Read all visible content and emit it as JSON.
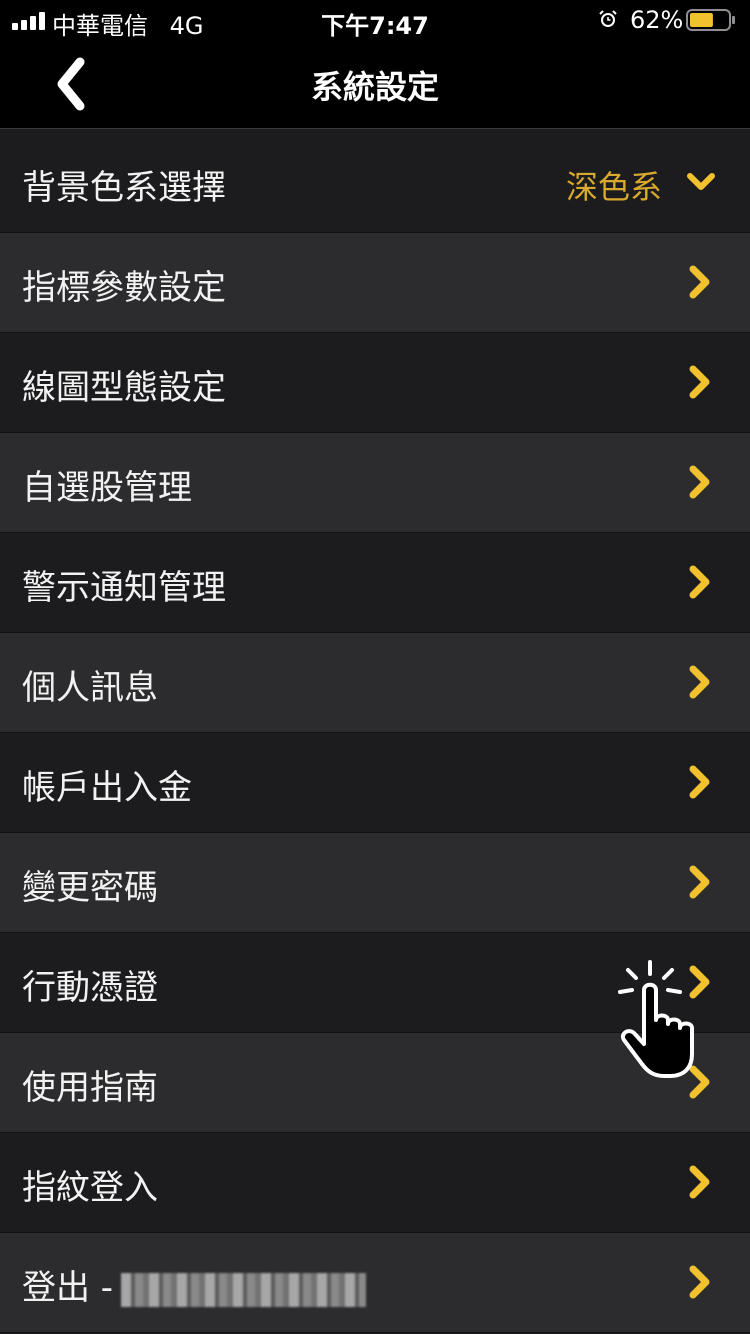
{
  "status_bar": {
    "carrier": "中華電信",
    "network": "4G",
    "time": "下午7:47",
    "battery_percent": "62%",
    "battery_level": 0.62
  },
  "nav": {
    "title": "系統設定"
  },
  "theme": {
    "accent": "#f2c12e",
    "value_color": "#d8a92d",
    "row_dark": "#1c1c1e",
    "row_light": "#2c2c2e"
  },
  "settings": {
    "background_color": {
      "label": "背景色系選擇",
      "value": "深色系"
    },
    "items": [
      {
        "label": "指標參數設定"
      },
      {
        "label": "線圖型態設定"
      },
      {
        "label": "自選股管理"
      },
      {
        "label": "警示通知管理"
      },
      {
        "label": "個人訊息"
      },
      {
        "label": "帳戶出入金"
      },
      {
        "label": "變更密碼"
      },
      {
        "label": "行動憑證"
      },
      {
        "label": "使用指南"
      },
      {
        "label": "指紋登入"
      }
    ],
    "logout": {
      "label": "登出 -"
    }
  }
}
